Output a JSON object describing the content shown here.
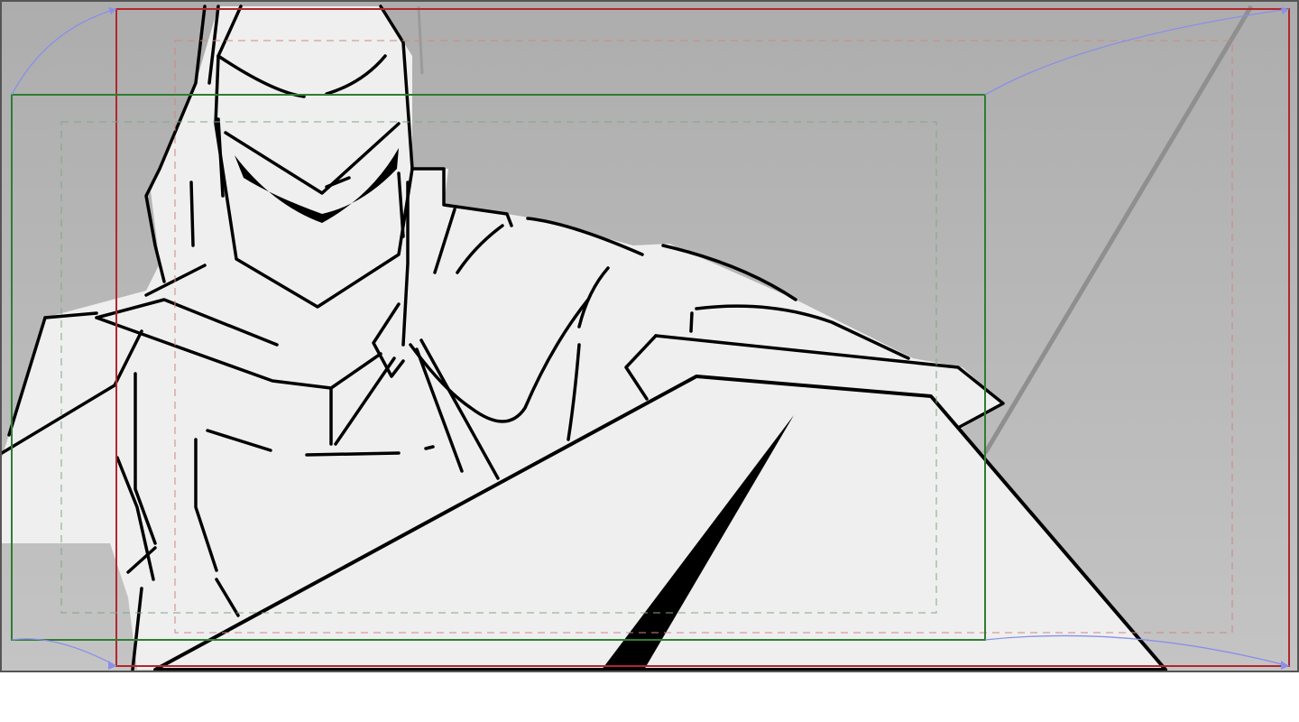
{
  "canvas": {
    "background_color": "#b4b4b4",
    "shape_fill_color": "#efefef",
    "ink_color": "#000000"
  },
  "camera_frames": {
    "start_frame_color": "#2e7d32",
    "end_frame_color": "#c62828",
    "motion_path_color": "#8a8fe8",
    "safe_area_style": "dashed"
  },
  "drawing": {
    "subject": "knight-helmet-sword-sketch"
  }
}
